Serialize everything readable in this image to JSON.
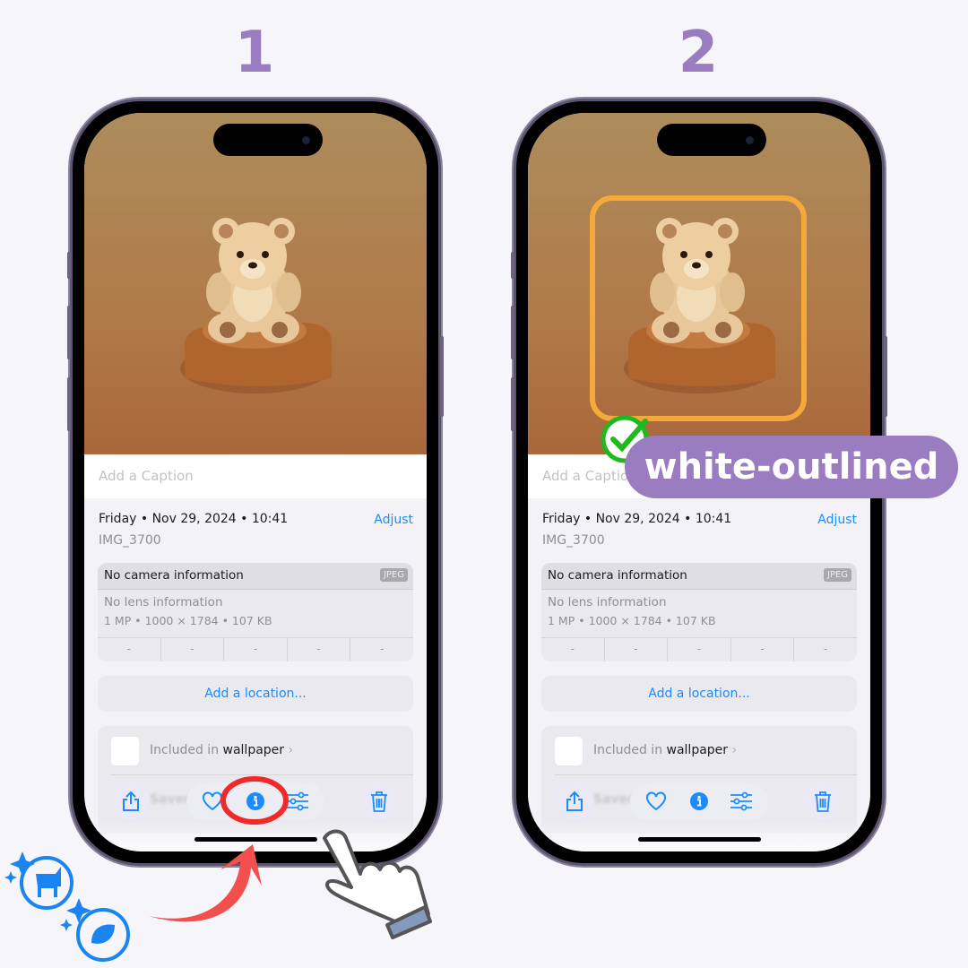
{
  "steps": [
    "1",
    "2"
  ],
  "phone": {
    "caption_placeholder": "Add a Caption",
    "date_line": "Friday • Nov 29, 2024 • 10:41",
    "adjust_label": "Adjust",
    "filename": "IMG_3700",
    "camera_info": "No camera information",
    "format_badge": "JPEG",
    "lens_info": "No lens information",
    "image_specs": "1 MP • 1000 × 1784 • 107 KB",
    "exif_placeholders": [
      "-",
      "-",
      "-",
      "-",
      "-"
    ],
    "add_location": "Add a location...",
    "included_prefix": "Included in",
    "album_name": "wallpaper",
    "saved_partial": "Saved",
    "toolbar": [
      "share-icon",
      "heart-icon",
      "info-icon",
      "sliders-icon",
      "trash-icon"
    ]
  },
  "annotation": {
    "label": "white-outlined",
    "highlight_color": "#f5a93a",
    "label_bg": "#9a7cc0",
    "check_color": "#1fb81f",
    "tap_highlight_color": "#f02a2a"
  },
  "accent": "#1a8cff"
}
